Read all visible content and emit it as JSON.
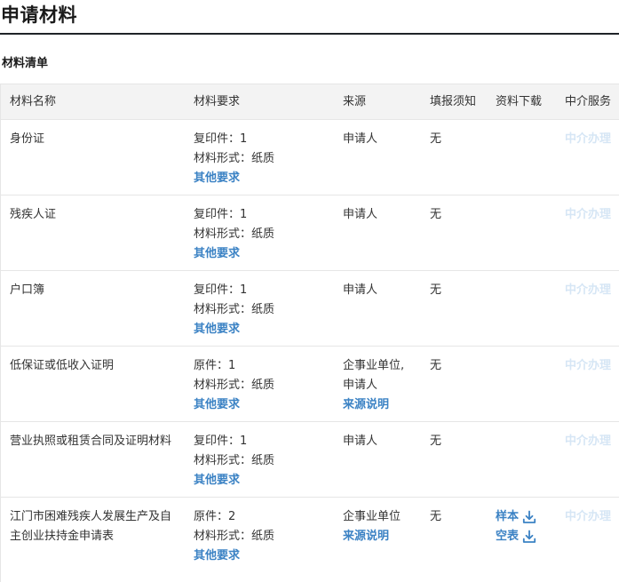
{
  "page": {
    "title": "申请材料",
    "section_title": "材料清单"
  },
  "table": {
    "headers": {
      "name": "材料名称",
      "requirement": "材料要求",
      "source": "来源",
      "fill_notice": "填报须知",
      "download": "资料下载",
      "agent": "中介服务"
    },
    "rows": [
      {
        "name": "身份证",
        "copies": "复印件：1",
        "form": "材料形式：纸质",
        "other": "其他要求",
        "source": "申请人",
        "source_note": "",
        "fill": "无",
        "agent": "中介办理"
      },
      {
        "name": "残疾人证",
        "copies": "复印件：1",
        "form": "材料形式：纸质",
        "other": "其他要求",
        "source": "申请人",
        "source_note": "",
        "fill": "无",
        "agent": "中介办理"
      },
      {
        "name": "户口簿",
        "copies": "复印件：1",
        "form": "材料形式：纸质",
        "other": "其他要求",
        "source": "申请人",
        "source_note": "",
        "fill": "无",
        "agent": "中介办理"
      },
      {
        "name": "低保证或低收入证明",
        "copies": "原件：1",
        "form": "材料形式：纸质",
        "other": "其他要求",
        "source": "企事业单位,申请人",
        "source_note": "来源说明",
        "fill": "无",
        "agent": "中介办理"
      },
      {
        "name": "营业执照或租赁合同及证明材料",
        "copies": "复印件：1",
        "form": "材料形式：纸质",
        "other": "其他要求",
        "source": "申请人",
        "source_note": "",
        "fill": "无",
        "agent": "中介办理"
      },
      {
        "name": "江门市困难残疾人发展生产及自主创业扶持金申请表",
        "copies": "原件：2",
        "form": "材料形式：纸质",
        "other": "其他要求",
        "source": "企事业单位",
        "source_note": "来源说明",
        "fill": "无",
        "download_sample": "样本",
        "download_blank": "空表",
        "download_icon": "download-icon",
        "agent": "中介办理"
      }
    ]
  },
  "colors": {
    "link": "#3b82c4",
    "agent_disabled": "#d6e6f5",
    "header_bg": "#f3f3f3",
    "border": "#e6e6e6"
  }
}
